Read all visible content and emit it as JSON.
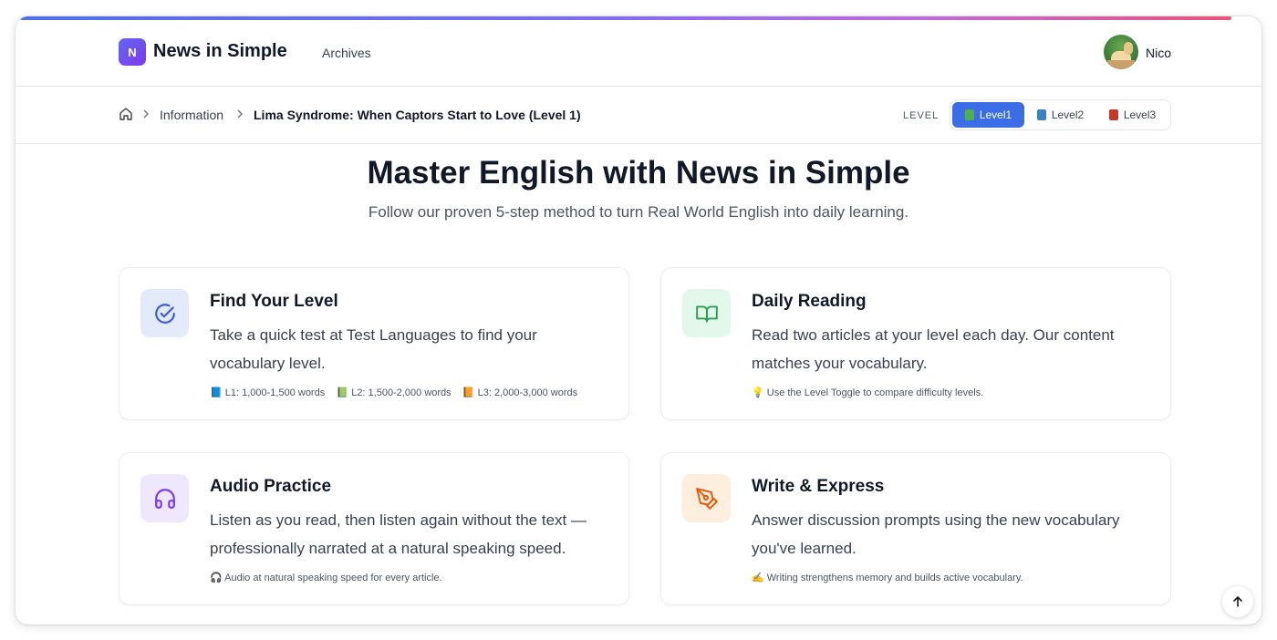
{
  "header": {
    "logo_letter": "N",
    "brand": "News in Simple",
    "nav_archives": "Archives",
    "user_name": "Nico"
  },
  "breadcrumb": {
    "items": [
      "Information",
      "Lima Syndrome: When Captors Start to Love (Level 1)"
    ]
  },
  "levels": {
    "label": "LEVEL",
    "options": [
      {
        "label": "Level1",
        "color": "#4caf50",
        "active": true
      },
      {
        "label": "Level2",
        "color": "#3b82c4",
        "active": false
      },
      {
        "label": "Level3",
        "color": "#c0392b",
        "active": false
      }
    ]
  },
  "hero": {
    "title": "Master English with News in Simple",
    "subtitle": "Follow our proven 5-step method to turn Real World English into daily learning."
  },
  "cards": [
    {
      "icon": "check-circle-icon",
      "icon_bg": "#e3ebfb",
      "icon_color": "#3b5bdb",
      "title": "Find Your Level",
      "desc": "Take a quick test at Test Languages to find your vocabulary level.",
      "note": "📘 L1: 1,000-1,500 words    📗 L2: 1,500-2,000 words    📙 L3: 2,000-3,000 words"
    },
    {
      "icon": "open-book-icon",
      "icon_bg": "#e3f7ea",
      "icon_color": "#2f9e5a",
      "title": "Daily Reading",
      "desc": "Read two articles at your level each day. Our content matches your vocabulary.",
      "note": "💡 Use the Level Toggle to compare difficulty levels."
    },
    {
      "icon": "headphones-icon",
      "icon_bg": "#efe7fb",
      "icon_color": "#7c3aed",
      "title": "Audio Practice",
      "desc": "Listen as you read, then listen again without the text — professionally narrated at a natural speaking speed.",
      "note": "🎧 Audio at natural speaking speed for every article."
    },
    {
      "icon": "pen-nib-icon",
      "icon_bg": "#fdeedd",
      "icon_color": "#e8590c",
      "title": "Write & Express",
      "desc": "Answer discussion prompts using the new vocabulary you've learned.",
      "note": "✍️ Writing strengthens memory and builds active vocabulary."
    }
  ]
}
